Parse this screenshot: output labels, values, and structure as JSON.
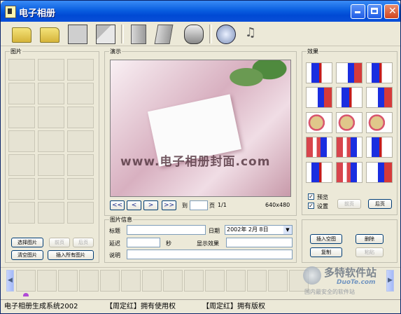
{
  "title": "电子相册",
  "groups": {
    "pictures": "图片",
    "preview": "演示",
    "effects": "效果",
    "info": "图片信息"
  },
  "left_buttons": {
    "select_picture": "选择图片",
    "prev": "前页",
    "next": "后页",
    "clear_pictures": "清空图片",
    "insert_all": "插入所有图片"
  },
  "preview": {
    "watermark": "www.电子相册封面.com"
  },
  "nav": {
    "first": "<<",
    "prev": "<",
    "next": ">",
    "last": ">>",
    "goto_label": "到",
    "page_label": "页",
    "page_count": "1/1",
    "resolution": "640x480"
  },
  "info": {
    "title_label": "标题",
    "date_label": "日期",
    "date_value": "2002年 2月 8日",
    "delay_label": "延迟",
    "seconds_label": "秒",
    "show_effect_label": "显示效果",
    "desc_label": "说明"
  },
  "effects": {
    "preview_check": "预览",
    "settings_check": "设置",
    "prev": "前页",
    "next": "后页"
  },
  "actions": {
    "insert_blank": "插入空图",
    "delete": "删除",
    "copy": "复制",
    "paste": "粘贴"
  },
  "logo": {
    "text": "多特软件站",
    "site": "DuoTe.com",
    "tagline": "国内最安全的软件站"
  },
  "status": {
    "app_name": "电子相册生成系统2002",
    "rights1": "【周定红】拥有使用权",
    "rights2": "【周定红】拥有版权"
  }
}
